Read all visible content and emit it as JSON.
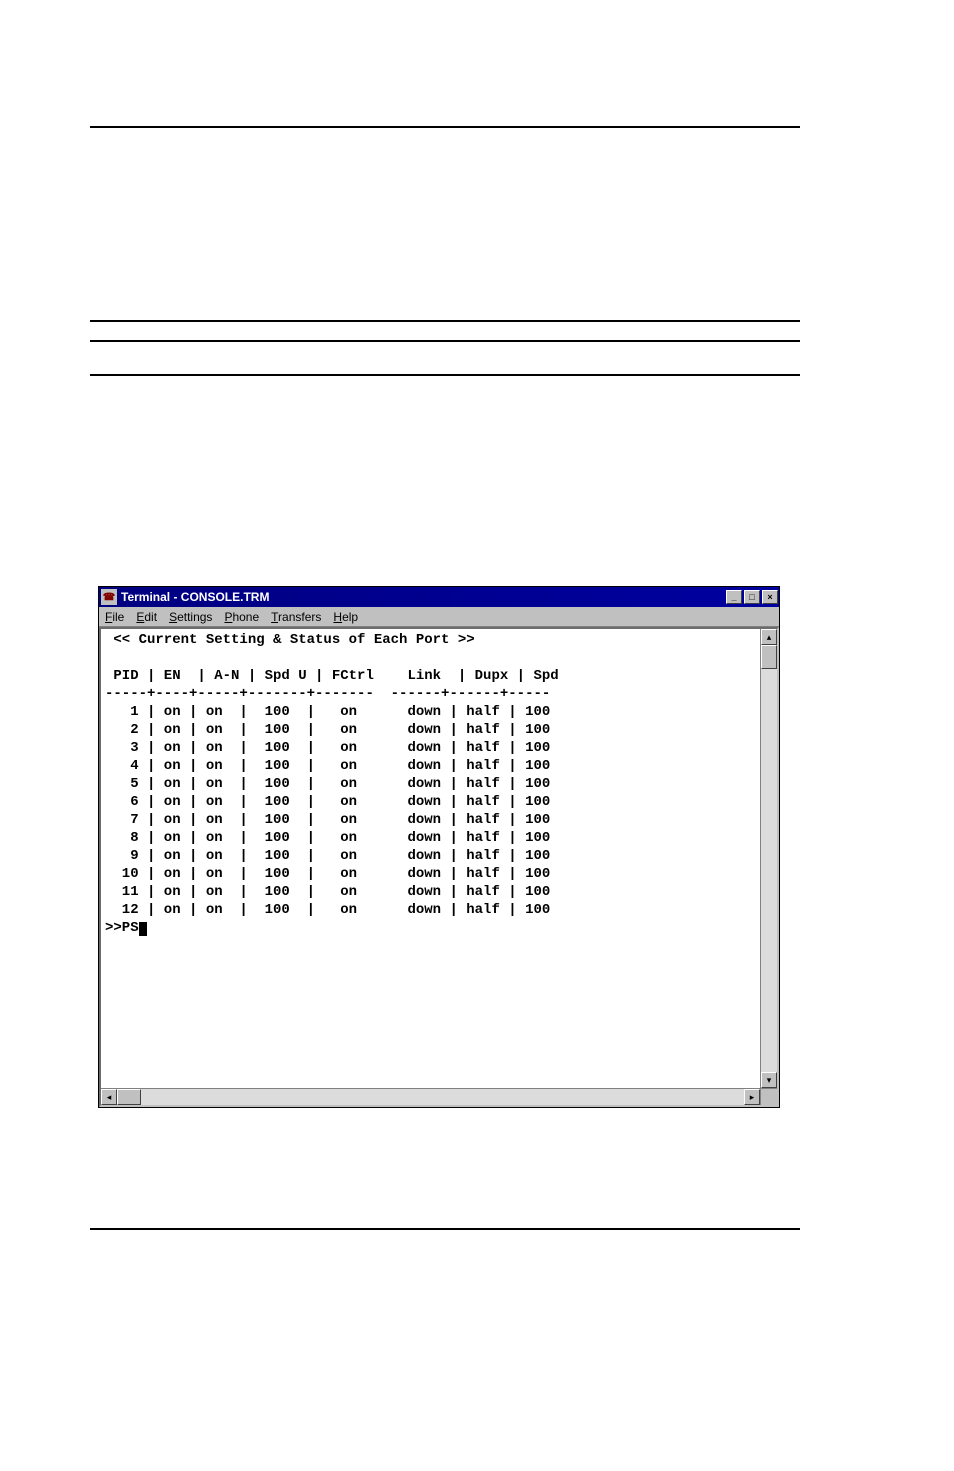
{
  "window": {
    "title": "Terminal - CONSOLE.TRM"
  },
  "menubar": {
    "items": [
      "File",
      "Edit",
      "Settings",
      "Phone",
      "Transfers",
      "Help"
    ]
  },
  "terminal": {
    "header": " << Current Setting & Status of Each Port >>",
    "columns_line": " PID | EN  | A-N | Spd U | FCtrl    Link  | Dupx | Spd",
    "separator": "-----+----+-----+-------+-------  ------+------+-----",
    "rows": [
      {
        "pid": "1",
        "en": "on",
        "an": "on",
        "spdu": "100",
        "fctrl": "on",
        "link": "down",
        "dupx": "half",
        "spd": "100"
      },
      {
        "pid": "2",
        "en": "on",
        "an": "on",
        "spdu": "100",
        "fctrl": "on",
        "link": "down",
        "dupx": "half",
        "spd": "100"
      },
      {
        "pid": "3",
        "en": "on",
        "an": "on",
        "spdu": "100",
        "fctrl": "on",
        "link": "down",
        "dupx": "half",
        "spd": "100"
      },
      {
        "pid": "4",
        "en": "on",
        "an": "on",
        "spdu": "100",
        "fctrl": "on",
        "link": "down",
        "dupx": "half",
        "spd": "100"
      },
      {
        "pid": "5",
        "en": "on",
        "an": "on",
        "spdu": "100",
        "fctrl": "on",
        "link": "down",
        "dupx": "half",
        "spd": "100"
      },
      {
        "pid": "6",
        "en": "on",
        "an": "on",
        "spdu": "100",
        "fctrl": "on",
        "link": "down",
        "dupx": "half",
        "spd": "100"
      },
      {
        "pid": "7",
        "en": "on",
        "an": "on",
        "spdu": "100",
        "fctrl": "on",
        "link": "down",
        "dupx": "half",
        "spd": "100"
      },
      {
        "pid": "8",
        "en": "on",
        "an": "on",
        "spdu": "100",
        "fctrl": "on",
        "link": "down",
        "dupx": "half",
        "spd": "100"
      },
      {
        "pid": "9",
        "en": "on",
        "an": "on",
        "spdu": "100",
        "fctrl": "on",
        "link": "down",
        "dupx": "half",
        "spd": "100"
      },
      {
        "pid": "10",
        "en": "on",
        "an": "on",
        "spdu": "100",
        "fctrl": "on",
        "link": "down",
        "dupx": "half",
        "spd": "100"
      },
      {
        "pid": "11",
        "en": "on",
        "an": "on",
        "spdu": "100",
        "fctrl": "on",
        "link": "down",
        "dupx": "half",
        "spd": "100"
      },
      {
        "pid": "12",
        "en": "on",
        "an": "on",
        "spdu": "100",
        "fctrl": "on",
        "link": "down",
        "dupx": "half",
        "spd": "100"
      }
    ],
    "prompt": ">>PS"
  }
}
